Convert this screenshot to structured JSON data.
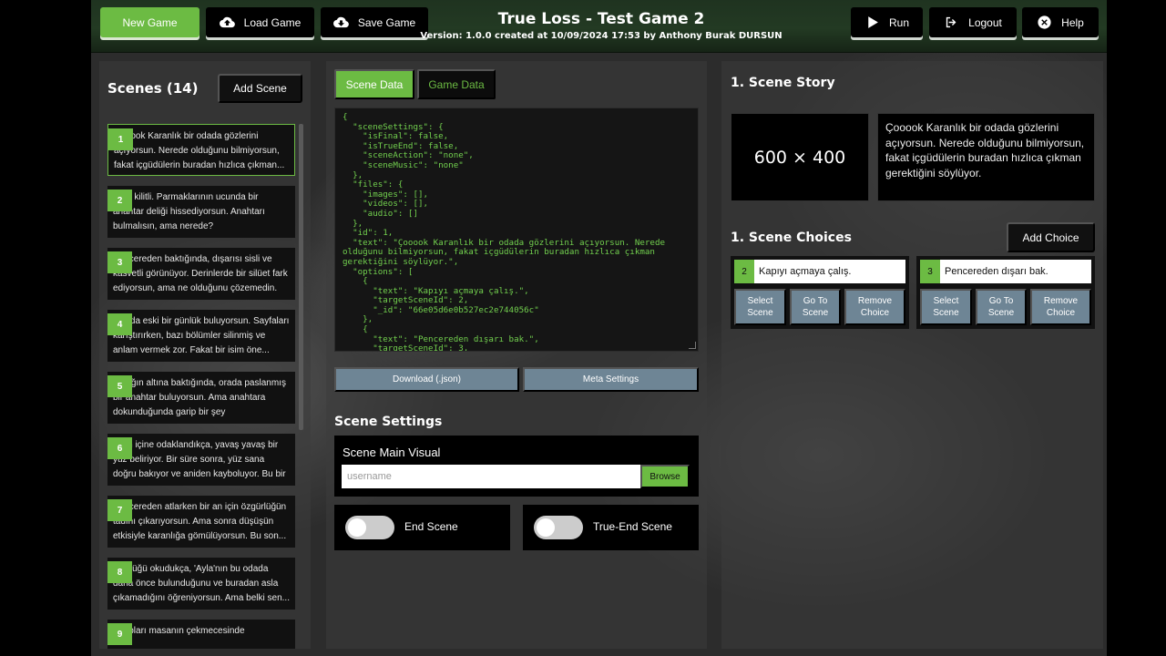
{
  "header": {
    "title": "True Loss - Test Game 2",
    "subtitle": "Version: 1.0.0 created at 10/09/2024 17:53 by Anthony Burak DURSUN",
    "buttons": {
      "new_game": "New Game",
      "load_game": "Load Game",
      "save_game": "Save Game",
      "run": "Run",
      "logout": "Logout",
      "help": "Help"
    }
  },
  "scenes": {
    "title": "Scenes (14)",
    "add_label": "Add Scene",
    "items": [
      {
        "num": "1",
        "text": "Çooook Karanlık bir odada gözlerini açıyorsun. Nerede olduğunu bilmiyorsun, fakat içgüdülerin buradan hızlıca çıkman..."
      },
      {
        "num": "2",
        "text": "Kapı kilitli. Parmaklarının ucunda bir anahtar deliği hissediyorsun. Anahtarı bulmalısın, ama nerede?"
      },
      {
        "num": "3",
        "text": "Pencereden baktığında, dışarısı sisli ve kasvetli görünüyor. Derinlerde bir silüet fark ediyorsun, ama ne olduğunu çözemedin."
      },
      {
        "num": "4",
        "text": "Odada eski bir günlük buluyorsun. Sayfaları karıştırırken, bazı bölümler silinmiş ve anlam vermek zor. Fakat bir isim öne..."
      },
      {
        "num": "5",
        "text": "Yatağın altına baktığında, orada paslanmış bir anahtar buluyorsun. Ama anahtara dokunduğunda garip bir şey hissediyorsun..."
      },
      {
        "num": "6",
        "text": "Sisin içine odaklandıkça, yavaş yavaş bir yüz beliriyor. Bir süre sonra, yüz sana doğru bakıyor ve aniden kayboluyor. Bu bir işaret..."
      },
      {
        "num": "7",
        "text": "Pencereden atlarken bir an için özgürlüğün tadını çıkarıyorsun. Ama sonra düşüşün etkisiyle karanlığa gömülüyorsun. Bu son..."
      },
      {
        "num": "8",
        "text": "Günlüğü okudukça, 'Ayla'nın bu odada daha önce bulunduğunu ve buradan asla çıkamadığını öğreniyorsun. Ama belki sen..."
      },
      {
        "num": "9",
        "text": "Kitapları masanın çekmecesinde"
      }
    ]
  },
  "tabs": {
    "scene_data": "Scene Data",
    "game_data": "Game Data"
  },
  "json_text": "{\n  \"sceneSettings\": {\n    \"isFinal\": false,\n    \"isTrueEnd\": false,\n    \"sceneAction\": \"none\",\n    \"sceneMusic\": \"none\"\n  },\n  \"files\": {\n    \"images\": [],\n    \"videos\": [],\n    \"audio\": []\n  },\n  \"id\": 1,\n  \"text\": \"Çooook Karanlık bir odada gözlerini açıyorsun. Nerede olduğunu bilmiyorsun, fakat içgüdülerin buradan hızlıca çıkman gerektiğini söylüyor.\",\n  \"options\": [\n    {\n      \"text\": \"Kapıyı açmaya çalış.\",\n      \"targetSceneId\": 2,\n      \"_id\": \"66e05d6e0b527ec2e744056c\"\n    },\n    {\n      \"text\": \"Pencereden dışarı bak.\",\n      \"targetSceneId\": 3,",
  "actions": {
    "download": "Download (.json)",
    "meta": "Meta Settings"
  },
  "scene_settings": {
    "title": "Scene Settings",
    "visual_label": "Scene Main Visual",
    "visual_placeholder": "username",
    "browse": "Browse",
    "end_scene": "End Scene",
    "true_end_scene": "True-End Scene",
    "end_scene_on": false,
    "true_end_scene_on": false
  },
  "story": {
    "title": "1. Scene Story",
    "image_placeholder": "600 × 400",
    "text": "Çooook Karanlık bir odada gözlerini açıyorsun. Nerede olduğunu bilmiyorsun, fakat içgüdülerin buradan hızlıca çıkman gerektiğini söylüyor."
  },
  "choices": {
    "title": "1. Scene Choices",
    "add_label": "Add Choice",
    "select_label": "Select Scene",
    "goto_label": "Go To Scene",
    "remove_label": "Remove Choice",
    "items": [
      {
        "num": "2",
        "text": "Kapıyı açmaya çalış."
      },
      {
        "num": "3",
        "text": "Pencereden dışarı bak."
      }
    ]
  },
  "colors": {
    "accent": "#6cbb43",
    "secondary_button": "#6e8595",
    "json_text": "#72d04e"
  },
  "icons": {
    "load": "cloud-upload-icon",
    "save": "cloud-download-icon",
    "run": "play-icon",
    "logout": "logout-icon",
    "help": "help-icon"
  }
}
